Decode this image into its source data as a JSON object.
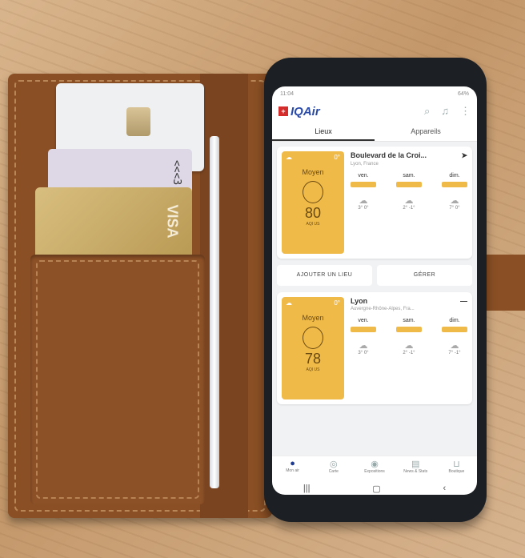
{
  "wallet": {
    "id_card_text": "<<<3",
    "gold_card_text": "VISA"
  },
  "phone": {
    "status": {
      "time": "11:04",
      "battery": "64%"
    },
    "app": {
      "logo_flag": "+",
      "logo_text": "IQAir"
    },
    "tabs": [
      "Lieux",
      "Appareils"
    ],
    "locations": [
      {
        "name": "Boulevard de la Croi...",
        "subtitle": "Lyon, France",
        "temp": "0°",
        "level": "Moyen",
        "aqi": "80",
        "unit": "AQI US",
        "days": [
          {
            "label": "ven.",
            "t": "3° 0°"
          },
          {
            "label": "sam.",
            "t": "2° -1°"
          },
          {
            "label": "dim.",
            "t": "7° 0°"
          }
        ]
      },
      {
        "name": "Lyon",
        "subtitle": "Auvergne-Rhône-Alpes, Fra...",
        "temp": "0°",
        "level": "Moyen",
        "aqi": "78",
        "unit": "AQI US",
        "days": [
          {
            "label": "ven.",
            "t": "3° 0°"
          },
          {
            "label": "sam.",
            "t": "2° -1°"
          },
          {
            "label": "dim.",
            "t": "7° -1°"
          }
        ]
      }
    ],
    "actions": {
      "add": "AJOUTER UN LIEU",
      "manage": "GÉRER"
    },
    "nav": [
      "Mon air",
      "Carte",
      "Expositions",
      "News & Stats",
      "Boutique"
    ],
    "colors": {
      "aqi_moderate": "#f0ba49",
      "brand": "#2a4aa8"
    }
  }
}
